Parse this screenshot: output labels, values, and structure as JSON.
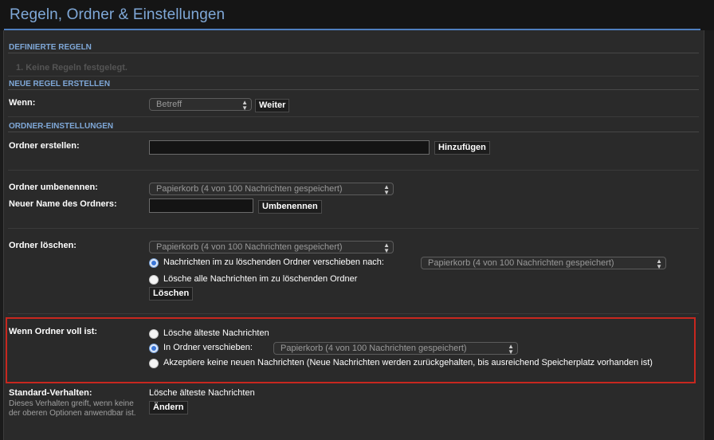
{
  "page": {
    "title": "Regeln, Ordner & Einstellungen"
  },
  "sections": {
    "defined_rules": "DEFINIERTE REGELN",
    "new_rule": "NEUE REGEL ERSTELLEN",
    "folder_settings": "ORDNER-EINSTELLUNGEN"
  },
  "defined_rules": {
    "items": [
      "1.  Keine Regeln festgelegt."
    ]
  },
  "new_rule": {
    "when_label": "Wenn:",
    "condition_select": "Betreff",
    "next_button": "Weiter"
  },
  "create_folder": {
    "label": "Ordner erstellen:",
    "input_value": "",
    "add_button": "Hinzufügen"
  },
  "rename_folder": {
    "label": "Ordner umbenennen:",
    "folder_select": "Papierkorb (4 von 100 Nachrichten gespeichert)",
    "new_name_label": "Neuer Name des Ordners:",
    "new_name_value": "",
    "rename_button": "Umbenennen"
  },
  "delete_folder": {
    "label": "Ordner löschen:",
    "folder_select": "Papierkorb (4 von 100 Nachrichten gespeichert)",
    "option_move": "Nachrichten im zu löschenden Ordner verschieben nach:",
    "move_target_select": "Papierkorb (4 von 100 Nachrichten gespeichert)",
    "option_delete_all": "Lösche alle Nachrichten im zu löschenden Ordner",
    "delete_button": "Löschen"
  },
  "folder_full": {
    "label": "Wenn Ordner voll ist:",
    "option_delete_oldest": "Lösche älteste Nachrichten",
    "option_move": "In Ordner verschieben:",
    "move_target_select": "Papierkorb (4 von 100 Nachrichten gespeichert)",
    "option_reject": "Akzeptiere keine neuen Nachrichten (Neue Nachrichten werden zurückgehalten, bis ausreichend Speicherplatz vorhanden ist)",
    "highlight_color": "#c8271f"
  },
  "default_behavior": {
    "label": "Standard-Verhalten:",
    "description": "Dieses Verhalten greift, wenn keine der oberen Optionen anwendbar ist.",
    "current_value": "Lösche älteste Nachrichten",
    "change_button": "Ändern"
  },
  "colors": {
    "accent": "#7fa8d8",
    "header_line": "#4f7fbf",
    "panel_bg": "#2a2a2a",
    "page_bg": "#1b1b1b",
    "radio_checked": "#3a76d8"
  }
}
